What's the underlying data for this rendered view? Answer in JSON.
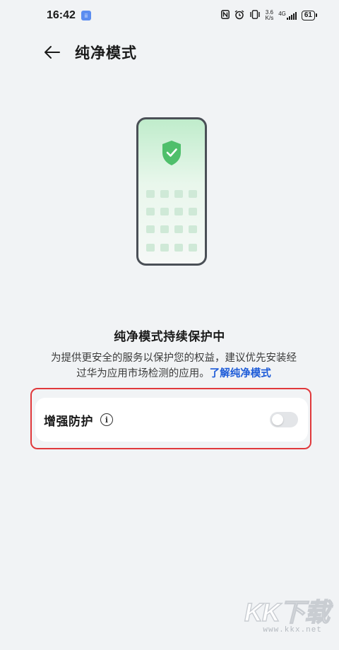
{
  "status_bar": {
    "time": "16:42",
    "notification_badge": "ii",
    "network_speed_value": "3.6",
    "network_speed_unit": "K/s",
    "network_type": "4G",
    "battery_level": "61",
    "icons": [
      "nfc-icon",
      "alarm-icon",
      "vibrate-icon",
      "signal-icon",
      "battery-icon"
    ]
  },
  "header": {
    "title": "纯净模式"
  },
  "main": {
    "heading": "纯净模式持续保护中",
    "description": "为提供更安全的服务以保护您的权益，建议优先安装经过华为应用市场检测的应用。",
    "learn_more_link": "了解纯净模式"
  },
  "setting": {
    "label": "增强防护",
    "enabled": false
  },
  "watermark": {
    "logo": "KK下载",
    "url": "www.kkx.net"
  },
  "colors": {
    "accent": "#1d5bd8",
    "shield": "#4fbf6b",
    "highlight_border": "#e0383b",
    "background": "#f1f3f5"
  }
}
